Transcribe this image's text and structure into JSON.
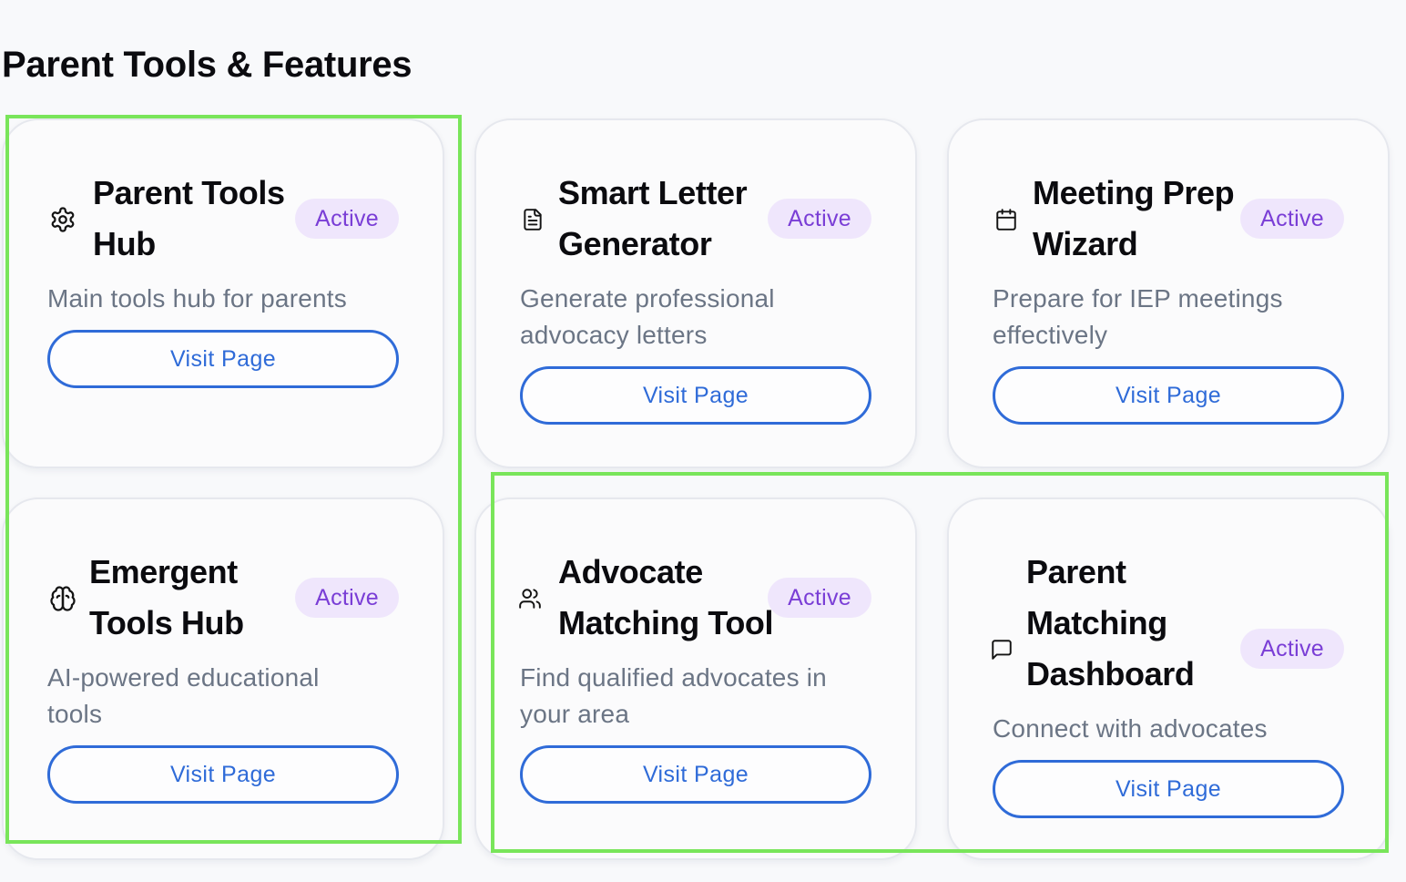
{
  "page_title": "Parent Tools & Features",
  "cards": [
    {
      "icon": "gear-icon",
      "title_line1": "Parent Tools",
      "title_line2": "Hub",
      "badge": "Active",
      "description": "Main tools hub for parents",
      "button": "Visit Page"
    },
    {
      "icon": "document-icon",
      "title_line1": "Smart Letter",
      "title_line2": "Generator",
      "badge": "Active",
      "description": "Generate professional advocacy letters",
      "button": "Visit Page"
    },
    {
      "icon": "calendar-icon",
      "title_line1": "Meeting Prep",
      "title_line2": "Wizard",
      "badge": "Active",
      "description": "Prepare for IEP meetings effectively",
      "button": "Visit Page"
    },
    {
      "icon": "brain-icon",
      "title_line1": "Emergent",
      "title_line2": "Tools Hub",
      "badge": "Active",
      "description": "AI-powered educational tools",
      "button": "Visit Page"
    },
    {
      "icon": "users-icon",
      "title_line1": "Advocate",
      "title_line2": "Matching Tool",
      "badge": "Active",
      "description": "Find qualified advocates in your area",
      "button": "Visit Page"
    },
    {
      "icon": "chat-icon",
      "title_line1": "Parent",
      "title_line2": "Matching",
      "title_line3": "Dashboard",
      "badge": "Active",
      "description": "Connect with advocates",
      "button": "Visit Page"
    }
  ],
  "colors": {
    "badge_bg": "#efe6fc",
    "badge_text": "#7a3ed6",
    "button_accent": "#2f6bd8",
    "highlight_outline": "#79e55a",
    "description_text": "#6b7585"
  }
}
